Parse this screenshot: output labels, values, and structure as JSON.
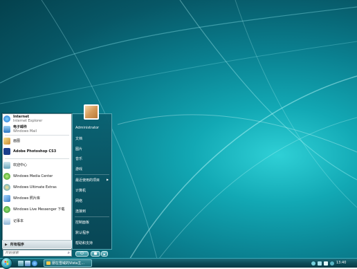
{
  "start_menu": {
    "pinned": [
      {
        "title": "Internet",
        "subtitle": "Internet Explorer",
        "icon": "internet-explorer-icon"
      },
      {
        "title": "电子邮件",
        "subtitle": "Windows Mail",
        "icon": "windows-mail-icon"
      }
    ],
    "recent": [
      {
        "title": "画图",
        "icon": "paint-icon"
      },
      {
        "title": "Adobe Photoshop CS3",
        "icon": "photoshop-icon"
      },
      {
        "title": "欢迎中心",
        "icon": "welcome-center-icon"
      },
      {
        "title": "Windows Media Center",
        "icon": "media-center-icon"
      },
      {
        "title": "Windows Ultimate Extras",
        "icon": "ultimate-extras-icon"
      },
      {
        "title": "Windows 照片库",
        "icon": "photo-gallery-icon"
      },
      {
        "title": "Windows Live Messenger 下载",
        "icon": "messenger-icon"
      },
      {
        "title": "记事本",
        "icon": "notepad-icon"
      }
    ],
    "all_programs": "所有程序",
    "search_placeholder": "开始搜索",
    "right": {
      "user": "Administrator",
      "documents": "文档",
      "pictures": "图片",
      "music": "音乐",
      "games": "游戏",
      "recent_items": "最近使用的项目",
      "computer": "计算机",
      "network": "网络",
      "connect_to": "连接到",
      "control_panel": "控制面板",
      "default_programs": "默认程序",
      "help": "帮助和支持"
    }
  },
  "taskbar": {
    "task_label": "朋在雪域的Vista主...",
    "clock": "13:40"
  },
  "colors": {
    "desktop": "#0a7f8f",
    "taskbar": "#0e4f5b",
    "menu_right": "#0a4f5e"
  }
}
